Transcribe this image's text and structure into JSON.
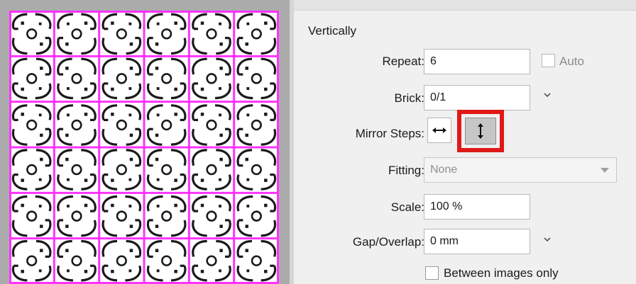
{
  "panel": {
    "section_title": "Vertically",
    "repeat": {
      "label": "Repeat:",
      "value": "6",
      "auto_label": "Auto",
      "auto_checked": false
    },
    "brick": {
      "label": "Brick:",
      "value": "0/1"
    },
    "mirror_steps": {
      "label": "Mirror Steps:",
      "horizontal_icon": "horizontal-arrow-icon",
      "vertical_icon": "vertical-arrow-icon",
      "selected": "vertical"
    },
    "fitting": {
      "label": "Fitting:",
      "value": "None",
      "disabled": true
    },
    "scale": {
      "label": "Scale:",
      "value": "100 %"
    },
    "gap_overlap": {
      "label": "Gap/Overlap:",
      "value": "0 mm"
    },
    "between_images_only": {
      "label": "Between images only",
      "checked": false
    }
  },
  "colors": {
    "grid_lines": "#ff33ff",
    "highlight": "#e01818",
    "pattern": "#1a1a1a"
  }
}
